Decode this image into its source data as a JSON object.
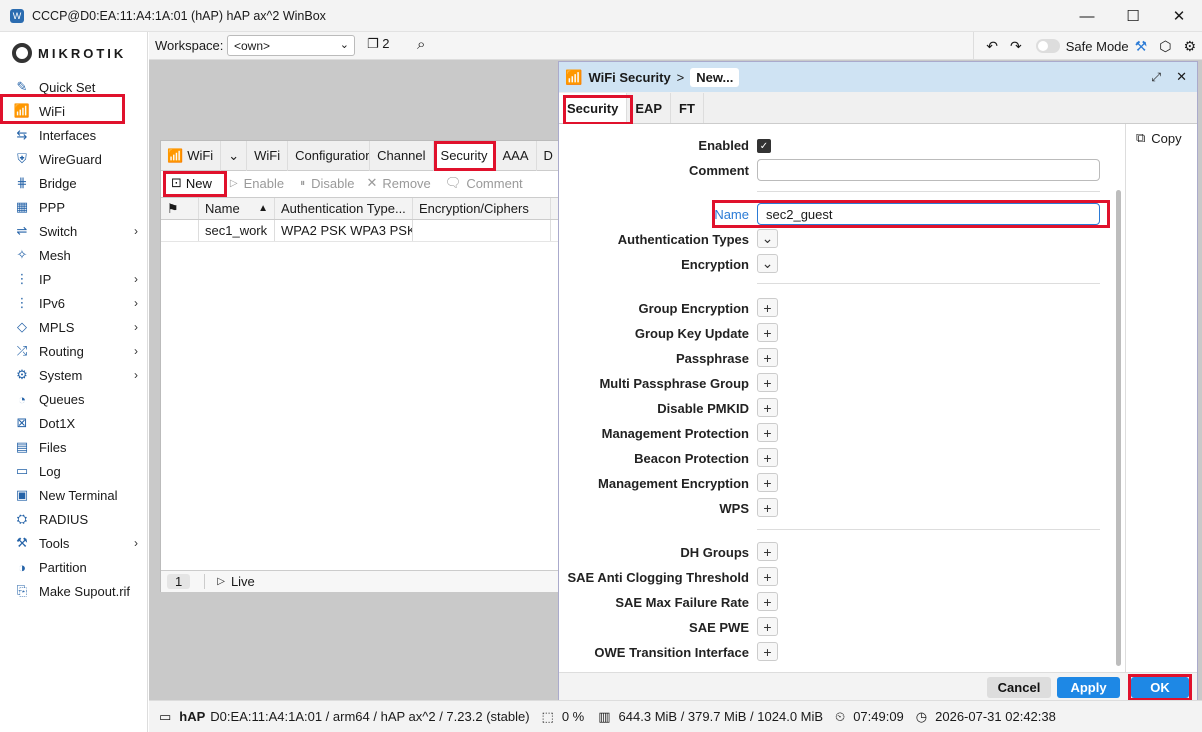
{
  "window": {
    "title": "CCCP@D0:EA:11:A4:1A:01 (hAP) hAP ax^2 WinBox"
  },
  "brand": "MIKROTIK",
  "sidebar": {
    "items": [
      {
        "label": "Quick Set"
      },
      {
        "label": "WiFi"
      },
      {
        "label": "Interfaces"
      },
      {
        "label": "WireGuard"
      },
      {
        "label": "Bridge"
      },
      {
        "label": "PPP"
      },
      {
        "label": "Switch"
      },
      {
        "label": "Mesh"
      },
      {
        "label": "IP"
      },
      {
        "label": "IPv6"
      },
      {
        "label": "MPLS"
      },
      {
        "label": "Routing"
      },
      {
        "label": "System"
      },
      {
        "label": "Queues"
      },
      {
        "label": "Dot1X"
      },
      {
        "label": "Files"
      },
      {
        "label": "Log"
      },
      {
        "label": "New Terminal"
      },
      {
        "label": "RADIUS"
      },
      {
        "label": "Tools"
      },
      {
        "label": "Partition"
      },
      {
        "label": "Make Supout.rif"
      }
    ]
  },
  "topbar": {
    "workspace_label": "Workspace:",
    "workspace_value": "<own>",
    "window_count": "2",
    "safe_mode": "Safe Mode"
  },
  "wifi_window": {
    "title": "WiFi",
    "tabs": [
      "WiFi",
      "Configuration",
      "Channel",
      "Security",
      "AAA",
      "D"
    ],
    "toolbar": {
      "new": "New",
      "enable": "Enable",
      "disable": "Disable",
      "remove": "Remove",
      "comment": "Comment"
    },
    "columns": [
      "Name",
      "Authentication Type...",
      "Encryption/Ciphers"
    ],
    "rows": [
      {
        "name": "sec1_work",
        "auth": "WPA2 PSK WPA3 PSK",
        "enc": ""
      }
    ],
    "footer": {
      "count": "1",
      "live": "Live"
    }
  },
  "security_window": {
    "title": "WiFi Security",
    "crumb": "New...",
    "tabs": [
      "Security",
      "EAP",
      "FT"
    ],
    "copy": "Copy",
    "fields": {
      "enabled": "Enabled",
      "comment": "Comment",
      "name": "Name",
      "name_value": "sec2_guest",
      "auth_types": "Authentication Types",
      "encryption": "Encryption"
    },
    "group1": [
      "Group Encryption",
      "Group Key Update",
      "Passphrase",
      "Multi Passphrase Group",
      "Disable PMKID",
      "Management Protection",
      "Beacon Protection",
      "Management Encryption",
      "WPS"
    ],
    "group2": [
      "DH Groups",
      "SAE Anti Clogging Threshold",
      "SAE Max Failure Rate",
      "SAE PWE",
      "OWE Transition Interface"
    ],
    "buttons": {
      "cancel": "Cancel",
      "apply": "Apply",
      "ok": "OK"
    }
  },
  "status": {
    "device": "hAP",
    "info": "D0:EA:11:A4:1A:01 / arm64 / hAP ax^2 / 7.23.2 (stable)",
    "cpu": "0 %",
    "memory": "644.3 MiB / 379.7 MiB / 1024.0 MiB",
    "uptime": "07:49:09",
    "datetime": "2026-07-31 02:42:38"
  },
  "colors": {
    "accent": "#2b7bd6",
    "highlight": "#e0112c",
    "ok": "#1e88e5"
  }
}
